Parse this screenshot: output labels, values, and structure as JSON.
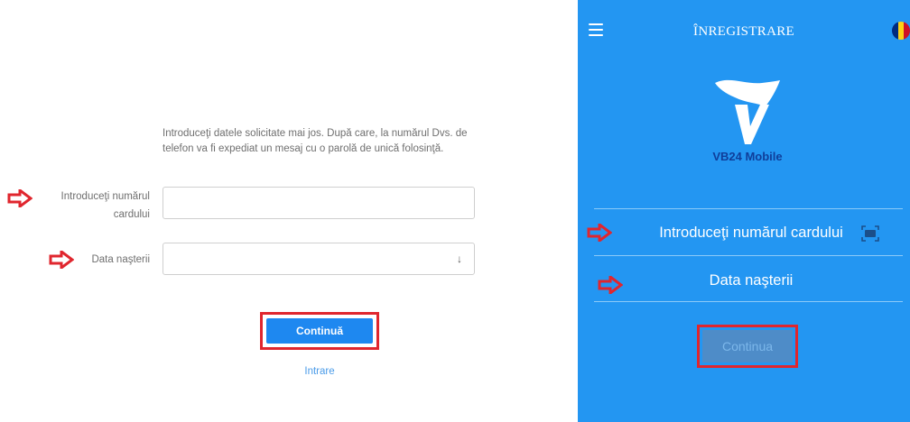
{
  "web": {
    "intro_text": "Introduceţi datele solicitate mai jos. După care, la numărul Dvs. de telefon va fi expediat un mesaj cu o parolă de unică folosinţă.",
    "card_label": "Introduceţi numărul cardului",
    "card_value": "",
    "birth_label": "Data naşterii",
    "birth_value": "",
    "dropdown_arrow": "↓",
    "continue_label": "Continuă",
    "login_link": "Intrare"
  },
  "mobile": {
    "title": "ÎNREGISTRARE",
    "logo_text": "VB24 Mobile",
    "card_field": "Introduceţi numărul cardului",
    "birth_field": "Data naşterii",
    "continue_label": "Continua",
    "flag_colors": [
      "#002b7f",
      "#fcd116",
      "#ce1126"
    ]
  },
  "colors": {
    "primary_blue": "#1e88f0",
    "app_background": "#2396f2",
    "highlight_red": "#e0262e",
    "annotation_arrow": "#e0262e"
  },
  "icons": {
    "annotation": "right-arrow-outline-icon",
    "menu": "hamburger-menu-icon",
    "scan": "card-scan-icon",
    "language": "romanian-flag-icon"
  }
}
